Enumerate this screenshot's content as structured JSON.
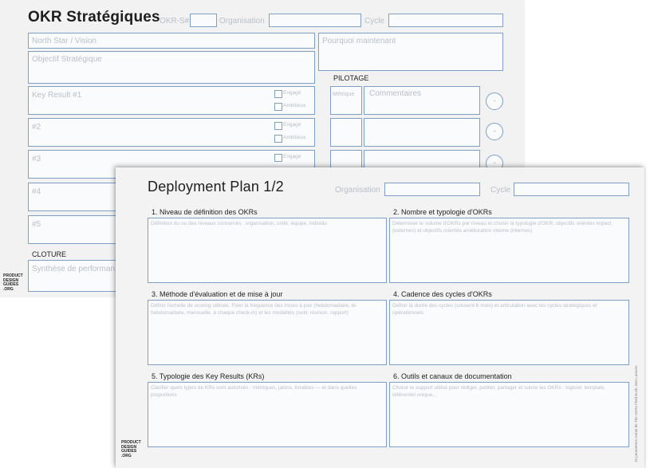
{
  "back_sheet": {
    "title": "OKR Stratégiques",
    "okr_id_label": "OKR-S#",
    "organisation_label": "Organisation",
    "cycle_label": "Cycle",
    "north_star": "North Star / Vision",
    "pourquoi": "Pourquoi maintenant",
    "objectif": "Objectif Stratégique",
    "pilotage": "PILOTAGE",
    "metrique": "Métrique",
    "commentaires": "Commentaires",
    "engage": "Engagé",
    "ambitieux": "Ambitieux",
    "key_results": [
      "Key Result #1",
      "#2",
      "#3",
      "#4",
      "#5"
    ],
    "cloture": "CLOTURE",
    "synthese": "Synthèse de performan",
    "circle_mark": "·",
    "logo": [
      "PRODUCT",
      "DESIGN",
      "GUIDES",
      ".ORG"
    ]
  },
  "front_sheet": {
    "title": "Deployment Plan 1/2",
    "organisation_label": "Organisation",
    "cycle_label": "Cycle",
    "sections": [
      {
        "title": "1. Niveau de définition des OKRs",
        "hint": "Définition du ou des niveaux concernés : organisation, unité, équipe, individu"
      },
      {
        "title": "2. Nombre et typologie d'OKRs",
        "hint": "Déterminer le volume d'OKRs par niveau et choisir la typologie d'OKR, objectifs orientés impact (externes) et objectifs orientés amélioration interne (internes)"
      },
      {
        "title": "3. Méthode d'évaluation et de mise à jour",
        "hint": "Définir l'échelle de scoring utilisée. Fixer la fréquence des mises à jour (hebdomadaire, bi-hebdomadaire, mensuelle, à chaque check-in) et les modalités (outil, réunion, rapport)"
      },
      {
        "title": "4. Cadence des cycles d'OKRs",
        "hint": "Définir la durée des cycles (souvent 6 mois) et articulation avec les cycles stratégiques et opérationnels"
      },
      {
        "title": "5. Typologie des Key Results (KRs)",
        "hint": "Clarifier quels types de KRs sont autorisés : métriques, jalons, livrables — et dans quelles proportions"
      },
      {
        "title": "6. Outils et canaux de documentation",
        "hint": "Choisir le support utilisé pour rédiger, publier, partager et suivre les OKRs : logiciel, template, référentiel unique..."
      }
    ],
    "vertical_note": "10 paramètres extrait de The OKRs Field Book, Ben Lamorte",
    "logo": [
      "PRODUCT",
      "DESIGN",
      "GUIDES",
      ".ORG"
    ]
  }
}
